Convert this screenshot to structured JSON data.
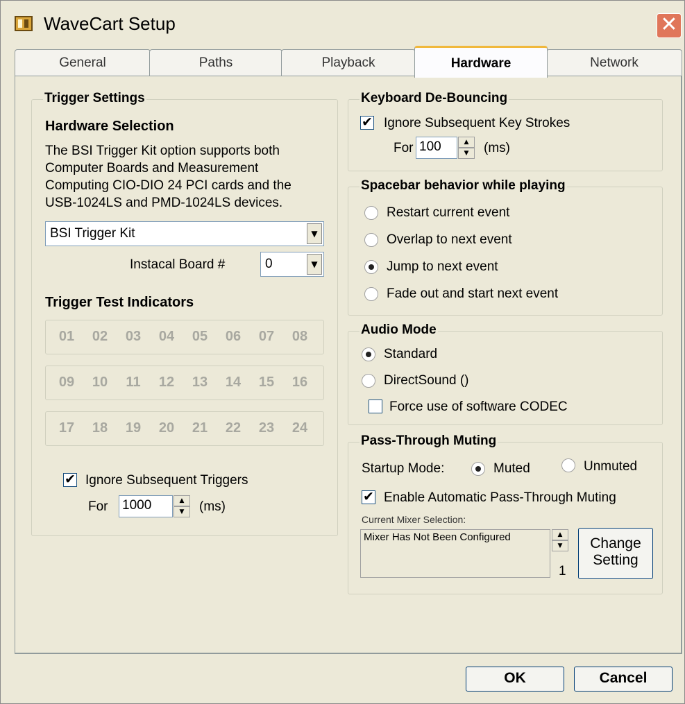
{
  "window": {
    "title": "WaveCart Setup",
    "close_glyph": "✕"
  },
  "tabs": [
    {
      "label": "General"
    },
    {
      "label": "Paths"
    },
    {
      "label": "Playback"
    },
    {
      "label": "Hardware",
      "active": true
    },
    {
      "label": "Network"
    }
  ],
  "trigger_settings": {
    "title": "Trigger Settings",
    "hardware_heading": "Hardware Selection",
    "description_lines": [
      "The BSI Trigger Kit option supports both",
      "Computer Boards and Measurement",
      "Computing CIO-DIO 24 PCI cards and the",
      "USB-1024LS and PMD-1024LS devices."
    ],
    "hardware_combo_value": "BSI Trigger Kit",
    "board_label": "Instacal Board #",
    "board_value": "0",
    "indicators_heading": "Trigger Test Indicators",
    "indicator_rows": [
      [
        "01",
        "02",
        "03",
        "04",
        "05",
        "06",
        "07",
        "08"
      ],
      [
        "09",
        "10",
        "11",
        "12",
        "13",
        "14",
        "15",
        "16"
      ],
      [
        "17",
        "18",
        "19",
        "20",
        "21",
        "22",
        "23",
        "24"
      ]
    ],
    "ignore_label": "Ignore Subsequent Triggers",
    "ignore_checked": true,
    "for_label": "For",
    "for_value": "1000",
    "unit_label": "(ms)"
  },
  "debounce": {
    "title": "Keyboard De-Bouncing",
    "ignore_label": "Ignore Subsequent Key Strokes",
    "ignore_checked": true,
    "for_label": "For",
    "for_value": "100",
    "unit_label": "(ms)"
  },
  "spacebar": {
    "title": "Spacebar behavior while playing",
    "options": [
      {
        "label": "Restart current event",
        "checked": false
      },
      {
        "label": "Overlap to next event",
        "checked": false
      },
      {
        "label": "Jump to next event",
        "checked": true
      },
      {
        "label": "Fade out and start next event",
        "checked": false
      }
    ]
  },
  "audio_mode": {
    "title": "Audio Mode",
    "standard_label": "Standard",
    "directsound_label": "DirectSound ()",
    "codec_label": "Force use of software CODEC"
  },
  "passthrough": {
    "title": "Pass-Through Muting",
    "startup_label": "Startup Mode:",
    "muted_label": "Muted",
    "unmuted_label": "Unmuted",
    "enable_label": "Enable Automatic Pass-Through Muting",
    "mixer_label": "Current Mixer Selection:",
    "mixer_value": "Mixer Has Not Been Configured",
    "mixer_index": "1",
    "change_line1": "Change",
    "change_line2": "Setting"
  },
  "footer": {
    "ok_label": "OK",
    "cancel_label": "Cancel"
  }
}
